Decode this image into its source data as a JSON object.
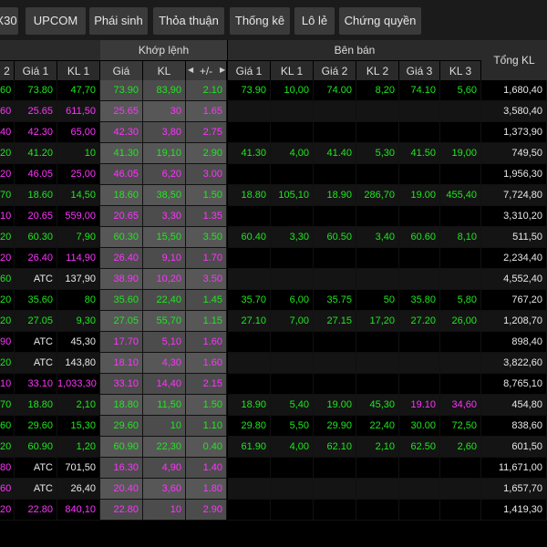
{
  "tabs": [
    "X30",
    "UPCOM",
    "Phái sinh",
    "Thỏa thuận",
    "Thống kê",
    "Lô lẻ",
    "Chứng quyền"
  ],
  "header": {
    "group_khop": "Khớp lệnh",
    "group_ban": "Bên bán",
    "total": "Tổng KL",
    "cols": [
      "2",
      "Giá 1",
      "KL 1",
      "Giá",
      "KL",
      "+/-",
      "Giá 1",
      "KL 1",
      "Giá 2",
      "KL 2",
      "Giá 3",
      "KL 3"
    ]
  },
  "rows": [
    [
      "60",
      "73.80",
      "47,70",
      "73.90",
      "83,90",
      "2.10",
      "73.90",
      "10,00",
      "74.00",
      "8,20",
      "74.10",
      "5,60",
      "1,680,40"
    ],
    [
      "60",
      "25.65",
      "611,50",
      "25.65",
      "30",
      "1.65",
      "",
      "",
      "",
      "",
      "",
      "",
      "3,580,40"
    ],
    [
      "40",
      "42.30",
      "65,00",
      "42.30",
      "3,80",
      "2.75",
      "",
      "",
      "",
      "",
      "",
      "",
      "1,373,90"
    ],
    [
      "20",
      "41.20",
      "10",
      "41.30",
      "19,10",
      "2.90",
      "41.30",
      "4,00",
      "41.40",
      "5,30",
      "41.50",
      "19,00",
      "749,50"
    ],
    [
      "20",
      "46.05",
      "25,00",
      "46.05",
      "6,20",
      "3.00",
      "",
      "",
      "",
      "",
      "",
      "",
      "1,956,30"
    ],
    [
      "70",
      "18.60",
      "14,50",
      "18.60",
      "38,50",
      "1.50",
      "18.80",
      "105,10",
      "18.90",
      "286,70",
      "19.00",
      "455,40",
      "7,724,80"
    ],
    [
      "10",
      "20.65",
      "559,00",
      "20.65",
      "3,30",
      "1.35",
      "",
      "",
      "",
      "",
      "",
      "",
      "3,310,20"
    ],
    [
      "20",
      "60.30",
      "7,90",
      "60.30",
      "15,50",
      "3.50",
      "60.40",
      "3,30",
      "60.50",
      "3,40",
      "60.60",
      "8,10",
      "511,50"
    ],
    [
      "20",
      "26.40",
      "114,90",
      "26.40",
      "9,10",
      "1.70",
      "",
      "",
      "",
      "",
      "",
      "",
      "2,234,40"
    ],
    [
      "60",
      "ATC",
      "137,90",
      "38.90",
      "10,20",
      "3.50",
      "",
      "",
      "",
      "",
      "",
      "",
      "4,552,40"
    ],
    [
      "20",
      "35.60",
      "80",
      "35.60",
      "22,40",
      "1.45",
      "35.70",
      "6,00",
      "35.75",
      "50",
      "35.80",
      "5,80",
      "767,20"
    ],
    [
      "20",
      "27.05",
      "9,30",
      "27.05",
      "55,70",
      "1.15",
      "27.10",
      "7,00",
      "27.15",
      "17,20",
      "27.20",
      "26,00",
      "1,208,70"
    ],
    [
      "90",
      "ATC",
      "45,30",
      "17.70",
      "5,10",
      "1.60",
      "",
      "",
      "",
      "",
      "",
      "",
      "898,40"
    ],
    [
      "20",
      "ATC",
      "143,80",
      "18.10",
      "4,30",
      "1.60",
      "",
      "",
      "",
      "",
      "",
      "",
      "3,822,60"
    ],
    [
      "10",
      "33.10",
      "1,033,30",
      "33.10",
      "14,40",
      "2.15",
      "",
      "",
      "",
      "",
      "",
      "",
      "8,765,10"
    ],
    [
      "70",
      "18.80",
      "2,10",
      "18.80",
      "11,50",
      "1.50",
      "18.90",
      "5,40",
      "19.00",
      "45,30",
      "19.10",
      "34,60",
      "454,80"
    ],
    [
      "60",
      "29.60",
      "15,30",
      "29.60",
      "10",
      "1.10",
      "29.80",
      "5,50",
      "29.90",
      "22,40",
      "30.00",
      "72,50",
      "838,60"
    ],
    [
      "20",
      "60.90",
      "1,20",
      "60.90",
      "22,30",
      "0.40",
      "61.90",
      "4,00",
      "62.10",
      "2,10",
      "62.50",
      "2,60",
      "601,50"
    ],
    [
      "80",
      "ATC",
      "701,50",
      "16.30",
      "4,90",
      "1.40",
      "",
      "",
      "",
      "",
      "",
      "",
      "11,671,00"
    ],
    [
      "60",
      "ATC",
      "26,40",
      "20.40",
      "3,60",
      "1.80",
      "",
      "",
      "",
      "",
      "",
      "",
      "1,657,70"
    ],
    [
      "20",
      "22.80",
      "840,10",
      "22.80",
      "10",
      "2.90",
      "",
      "",
      "",
      "",
      "",
      "",
      "1,419,30"
    ]
  ],
  "row_colors": [
    "uuuuuuuuuuuuw",
    "dddddd-------w",
    "dddddd-------w",
    "uuuuuuuuuuuuw",
    "dddddd-------w",
    "uuuuuuuuuuuuw",
    "dddddd-------w",
    "uuuuuuuuuuuuw",
    "dddddd-------w",
    "uwwddd-------w",
    "uuuuuuuuuuuuw",
    "uuuuuuuuuuuuw",
    "dwwddd-------w",
    "uwwddd-------w",
    "dddddd-------w",
    "uuuuuuuuuudduw",
    "uuuuuuuuuuuuw",
    "uuuuuuuuuuuuw",
    "dwwddd-------w",
    "dwwddd-------w",
    "dddddd-------w"
  ],
  "colors": {
    "up": "#1ee81e",
    "down": "#ff33ff",
    "neutral": "#e8e8e8"
  }
}
